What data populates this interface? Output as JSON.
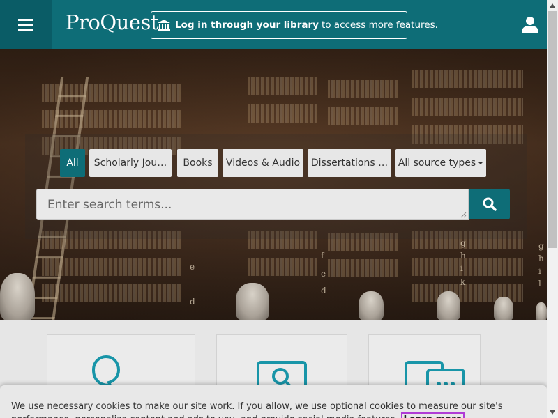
{
  "header": {
    "menu_icon": "hamburger-menu-icon",
    "logo_text": "ProQuest",
    "login": {
      "icon": "library-building-icon",
      "bold_text": "Log in through your library",
      "rest_text": "to access more features."
    },
    "user_icon": "user-icon",
    "colors": {
      "primary": "#0e6d77",
      "menu_bg": "#0a5c66"
    }
  },
  "hero": {
    "shelf_letters": [
      "e",
      "d",
      "f",
      "e",
      "d",
      "g",
      "h",
      "i",
      "k",
      "g",
      "h",
      "i",
      "l"
    ]
  },
  "tabs": [
    {
      "label": "All",
      "active": true
    },
    {
      "label": "Scholarly Jou…",
      "active": false
    },
    {
      "label": "Books",
      "active": false
    },
    {
      "label": "Videos & Audio",
      "active": false
    },
    {
      "label": "Dissertations …",
      "active": false
    },
    {
      "label": "All source types",
      "active": false,
      "dropdown": true
    }
  ],
  "search": {
    "placeholder": "Enter search terms...",
    "value": "",
    "button_icon": "search-icon"
  },
  "cards": [
    {
      "icon": "proquest-q-icon"
    },
    {
      "icon": "search-screen-icon"
    },
    {
      "icon": "chat-screens-icon"
    }
  ],
  "cookie_banner": {
    "text_before": "We use necessary cookies to make our site work. If you allow, we use ",
    "link_text": "optional cookies",
    "text_after": " to measure our site's performance, personalize content and ads to you, and provide social media features.",
    "learn_more": "Learn more"
  }
}
